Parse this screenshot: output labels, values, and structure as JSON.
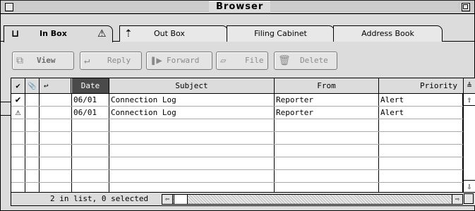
{
  "window": {
    "title": "Browser"
  },
  "tabs": [
    {
      "label": "In Box",
      "active": true,
      "icon": "inbox-tray-icon",
      "badge_icon": "warning-triangle-icon"
    },
    {
      "label": "Out Box",
      "active": false,
      "icon": "upload-arrow-icon"
    },
    {
      "label": "Filing Cabinet",
      "active": false
    },
    {
      "label": "Address Book",
      "active": false
    }
  ],
  "toolbar": {
    "view_label": "View",
    "reply_label": "Reply",
    "forward_label": "Forward",
    "file_label": "File",
    "delete_label": "Delete"
  },
  "columns": {
    "status": "✔",
    "attachment": "📎",
    "replied": "↩",
    "date": "Date",
    "subject": "Subject",
    "from": "From",
    "priority": "Priority"
  },
  "messages": [
    {
      "status_icon": "checkmark-icon",
      "status_glyph": "✔",
      "date": "06/01",
      "subject": "Connection Log",
      "from": "Reporter",
      "priority": "Alert"
    },
    {
      "status_icon": "warning-triangle-icon",
      "status_glyph": "⚠",
      "date": "06/01",
      "subject": "Connection Log",
      "from": "Reporter",
      "priority": "Alert"
    }
  ],
  "status": {
    "summary": "2 in list, 0 selected"
  }
}
